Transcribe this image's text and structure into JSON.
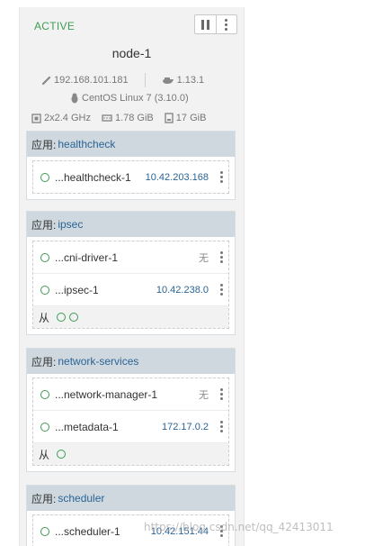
{
  "host": {
    "state": "ACTIVE",
    "name": "node-1",
    "ip": "192.168.101.181",
    "docker_version": "1.13.1",
    "os": "CentOS Linux 7 (3.10.0)",
    "cpu": "2x2.4 GHz",
    "memory": "1.78 GiB",
    "storage": "17 GiB",
    "icons": [
      "pause-icon",
      "more-vertical-icon",
      "link-icon",
      "docker-whale-icon",
      "linux-tux-icon",
      "cpu-icon",
      "memory-icon",
      "storage-icon"
    ]
  },
  "labels": {
    "stack_prefix": "应用:",
    "sidekick": "从"
  },
  "stacks": [
    {
      "name": "healthcheck",
      "containers": [
        {
          "name": "...healthcheck-1",
          "ip": "10.42.203.168"
        }
      ]
    },
    {
      "name": "ipsec",
      "containers": [
        {
          "name": "...cni-driver-1",
          "ip": "无"
        },
        {
          "name": "...ipsec-1",
          "ip": "10.42.238.0"
        }
      ],
      "sidekick_count": 2
    },
    {
      "name": "network-services",
      "containers": [
        {
          "name": "...network-manager-1",
          "ip": "无"
        },
        {
          "name": "...metadata-1",
          "ip": "172.17.0.2"
        }
      ],
      "sidekick_count": 1
    },
    {
      "name": "scheduler",
      "containers": [
        {
          "name": "...scheduler-1",
          "ip": "10.42.151.44"
        }
      ]
    }
  ],
  "colors": {
    "active": "#3e9c54",
    "link": "#2a6496",
    "header_bg": "#cfd8de"
  },
  "watermark": "https://blog.csdn.net/qq_42413011"
}
